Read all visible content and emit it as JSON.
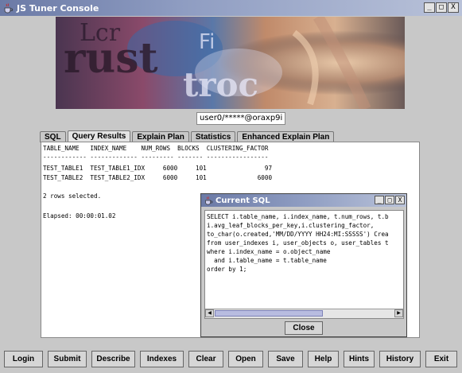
{
  "window": {
    "title": "JS Tuner Console",
    "minimize": "_",
    "maximize": "□",
    "close": "X"
  },
  "connection": "user0/*****@oraxp9i",
  "tabs": [
    "SQL",
    "Query Results",
    "Explain Plan",
    "Statistics",
    "Enhanced Explain Plan"
  ],
  "active_tab": "Query Results",
  "results": {
    "lines": [
      "TABLE_NAME   INDEX_NAME    NUM_ROWS  BLOCKS  CLUSTERING_FACTOR",
      "------------ ------------- --------- ------- -----------------",
      "",
      "TEST_TABLE1  TEST_TABLE1_IDX     6000     101                97",
      "TEST_TABLE2  TEST_TABLE2_IDX     6000     101              6000",
      "",
      "",
      "2 rows selected.",
      "",
      "",
      "Elapsed: 00:00:01.02"
    ]
  },
  "dialog": {
    "title": "Current SQL",
    "sql_lines": [
      "SELECT i.table_name, i.index_name, t.num_rows, t.b",
      "i.avg_leaf_blocks_per_key,i.clustering_factor,",
      "to_char(o.created,'MM/DD/YYYY HH24:MI:SSSSS') Crea",
      "from user_indexes i, user_objects o, user_tables t",
      "where i.index_name = o.object_name",
      "  and i.table_name = t.table_name",
      "order by 1;"
    ],
    "close_label": "Close"
  },
  "buttons": [
    "Login",
    "Submit",
    "Describe",
    "Indexes",
    "Clear",
    "Open",
    "Save",
    "Help",
    "Hints",
    "History",
    "Exit"
  ],
  "colors": {
    "titlebar": "#6b7aa6",
    "background": "#c8c8c8",
    "scroll_thumb": "#b8bce0"
  }
}
